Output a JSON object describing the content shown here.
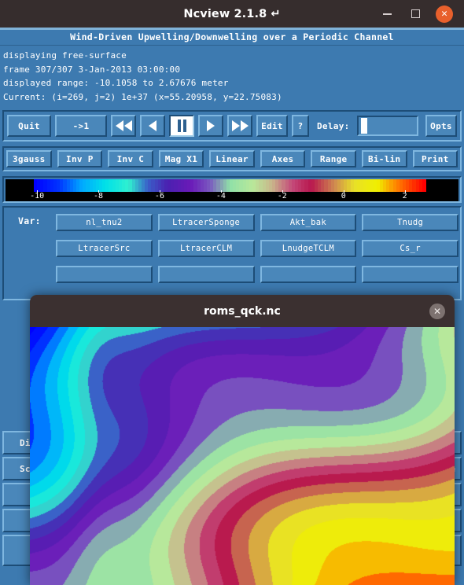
{
  "window": {
    "title": "Ncview 2.1.8 ↵",
    "minimize_icon": "minimize-icon",
    "maximize_icon": "maximize-icon",
    "close_icon": "close-icon",
    "close_glyph": "✕"
  },
  "ncview": {
    "banner": "Wind-Driven Upwelling/Downwelling over a Periodic Channel",
    "info": {
      "line1": "displaying free-surface",
      "line2": "frame 307/307 3-Jan-2013 03:00:00",
      "line3": "displayed range: -10.1058 to 2.67676 meter",
      "line4": "Current: (i=269, j=2) 1e+37 (x=55.20958, y=22.75083)"
    },
    "controls": {
      "quit": "Quit",
      "to_first": "->1",
      "rewind_icon": "rewind-icon",
      "back_icon": "step-back-icon",
      "pause_icon": "pause-icon",
      "forward_icon": "step-forward-icon",
      "fastforward_icon": "fast-forward-icon",
      "edit": "Edit",
      "help": "?",
      "delay_label": "Delay:",
      "delay_value": "",
      "opts": "Opts"
    },
    "options": [
      "3gauss",
      "Inv P",
      "Inv C",
      "Mag X1",
      "Linear",
      "Axes",
      "Range",
      "Bi-lin",
      "Print"
    ],
    "colorbar": {
      "ticks": [
        -10,
        -8,
        -6,
        -4,
        -2,
        0,
        2
      ],
      "tick_labels": [
        "-10",
        "-8",
        "-6",
        "-4",
        "-2",
        "0",
        "2"
      ],
      "min": -10.1058,
      "max": 2.67676,
      "units": "meter",
      "background": "#000000"
    },
    "var_label": "Var:",
    "var_rows": [
      [
        "nl_tnu2",
        "LtracerSponge",
        "Akt_bak",
        "Tnudg"
      ],
      [
        "LtracerSrc",
        "LtracerCLM",
        "LnudgeTCLM",
        "Cs_r"
      ],
      [
        "",
        "",
        "",
        ""
      ]
    ],
    "lower_rows": [
      {
        "left": "Dim",
        "right": ""
      },
      {
        "left": "Sca",
        "right": "ce"
      },
      {
        "left": "",
        "right": ""
      },
      {
        "left": "",
        "right": ""
      },
      {
        "left": "",
        "right": ""
      }
    ]
  },
  "dialog": {
    "title": "roms_qck.nc",
    "close_icon": "close-icon",
    "close_glyph": "✕",
    "background": "#fdfbf2",
    "map_name": "free-surface-field-map"
  },
  "chart_data": {
    "type": "heatmap",
    "title": "roms_qck.nc",
    "field": "free-surface",
    "units": "meter",
    "colormap": "3gauss",
    "scale": "Linear",
    "interpolation": "Bi-lin",
    "vmin": -10.1058,
    "vmax": 2.67676,
    "colorbar_ticks": [
      -10,
      -8,
      -6,
      -4,
      -2,
      0,
      2
    ],
    "colorbar_stops": [
      {
        "pos": 0.0,
        "color": "#0000ff"
      },
      {
        "pos": 0.06,
        "color": "#0033ff"
      },
      {
        "pos": 0.12,
        "color": "#00aaff"
      },
      {
        "pos": 0.18,
        "color": "#00e0e8"
      },
      {
        "pos": 0.24,
        "color": "#30f0d0"
      },
      {
        "pos": 0.29,
        "color": "#3a5ec8"
      },
      {
        "pos": 0.34,
        "color": "#4a20b0"
      },
      {
        "pos": 0.4,
        "color": "#6a1ab8"
      },
      {
        "pos": 0.45,
        "color": "#7a5ac0"
      },
      {
        "pos": 0.5,
        "color": "#8fe0a8"
      },
      {
        "pos": 0.56,
        "color": "#b9e89a"
      },
      {
        "pos": 0.61,
        "color": "#c9b48a"
      },
      {
        "pos": 0.66,
        "color": "#c44a7a"
      },
      {
        "pos": 0.71,
        "color": "#b8174e"
      },
      {
        "pos": 0.77,
        "color": "#cf8a50"
      },
      {
        "pos": 0.82,
        "color": "#e8e028"
      },
      {
        "pos": 0.88,
        "color": "#f0f000"
      },
      {
        "pos": 0.93,
        "color": "#ff8000"
      },
      {
        "pos": 1.0,
        "color": "#ff0000"
      }
    ],
    "frame": 307,
    "frame_total": 307,
    "frame_time": "3-Jan-2013 03:00:00",
    "cursor": {
      "i": 269,
      "j": 2,
      "value": "1e+37",
      "x": 55.20958,
      "y": 22.75083
    }
  }
}
